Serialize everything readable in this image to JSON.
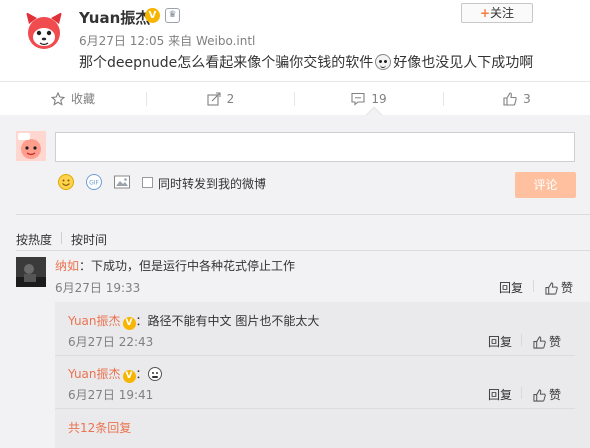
{
  "post": {
    "username": "Yuan振杰",
    "verified_badge": "V",
    "member_icon": "member-icon",
    "follow_label": "关注",
    "follow_plus": "+",
    "date": "6月27日 12:05",
    "source": "来自 Weibo.intl",
    "text_before_emoji": "那个deepnude怎么看起来像个骗你交钱的软件",
    "text_after_emoji": "好像也没见人下成功啊"
  },
  "actions": {
    "favorite_label": "收藏",
    "forward_count": "2",
    "comment_count": "19",
    "like_count": "3"
  },
  "composer": {
    "input_value": "",
    "also_forward_label": "同时转发到我的微博",
    "submit_label": "评论"
  },
  "sort": {
    "by_hot": "按热度",
    "by_time": "按时间"
  },
  "comments": [
    {
      "name": "纳如",
      "sep": "：",
      "text": "下成功，但是运行中各种花式停止工作",
      "time": "6月27日 19:33",
      "reply_label": "回复",
      "like_label": "赞"
    }
  ],
  "replies": [
    {
      "name": "Yuan振杰",
      "badge": "V",
      "sep": "：",
      "text": "路径不能有中文 图片也不能太大",
      "time": "6月27日 22:43",
      "reply_label": "回复",
      "like_label": "赞"
    },
    {
      "name": "Yuan振杰",
      "badge": "V",
      "sep": "：",
      "text": "",
      "time": "6月27日 19:41",
      "reply_label": "回复",
      "like_label": "赞"
    }
  ],
  "more_replies": "共12条回复",
  "colors": {
    "accent_orange": "#eb7350",
    "submit_disabled": "#ffc09f",
    "badge_gold": "#f7b500",
    "panel_bg": "#f2f2f5"
  }
}
